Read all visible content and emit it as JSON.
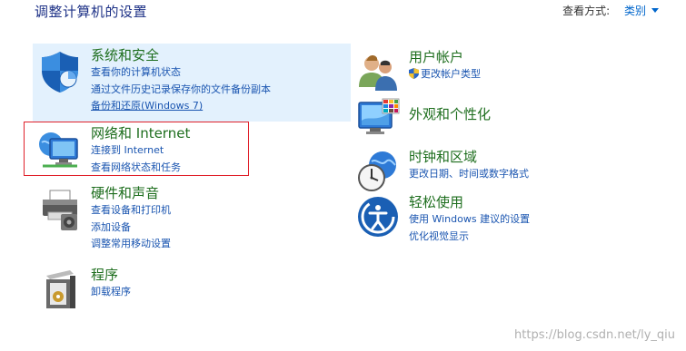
{
  "header": {
    "title": "调整计算机的设置",
    "view_by_label": "查看方式:",
    "view_by_value": "类别"
  },
  "left": [
    {
      "title": "系统和安全",
      "links": [
        "查看你的计算机状态",
        "通过文件历史记录保存你的文件备份副本",
        "备份和还原(Windows 7)"
      ],
      "icon": "shield-icon"
    },
    {
      "title": "网络和 Internet",
      "links": [
        "连接到 Internet",
        "查看网络状态和任务"
      ],
      "icon": "network-globe-icon"
    },
    {
      "title": "硬件和声音",
      "links": [
        "查看设备和打印机",
        "添加设备",
        "调整常用移动设置"
      ],
      "icon": "printer-icon"
    },
    {
      "title": "程序",
      "links": [
        "卸载程序"
      ],
      "icon": "programs-box-icon"
    }
  ],
  "right": [
    {
      "title": "用户帐户",
      "links": [
        "更改帐户类型"
      ],
      "icon": "users-icon"
    },
    {
      "title": "外观和个性化",
      "links": [],
      "icon": "monitor-palette-icon"
    },
    {
      "title": "时钟和区域",
      "links": [
        "更改日期、时间或数字格式"
      ],
      "icon": "clock-globe-icon"
    },
    {
      "title": "轻松使用",
      "links": [
        "使用 Windows 建议的设置",
        "优化视觉显示"
      ],
      "icon": "ease-of-access-icon"
    }
  ],
  "watermark": "https://blog.csdn.net/ly_qiu"
}
